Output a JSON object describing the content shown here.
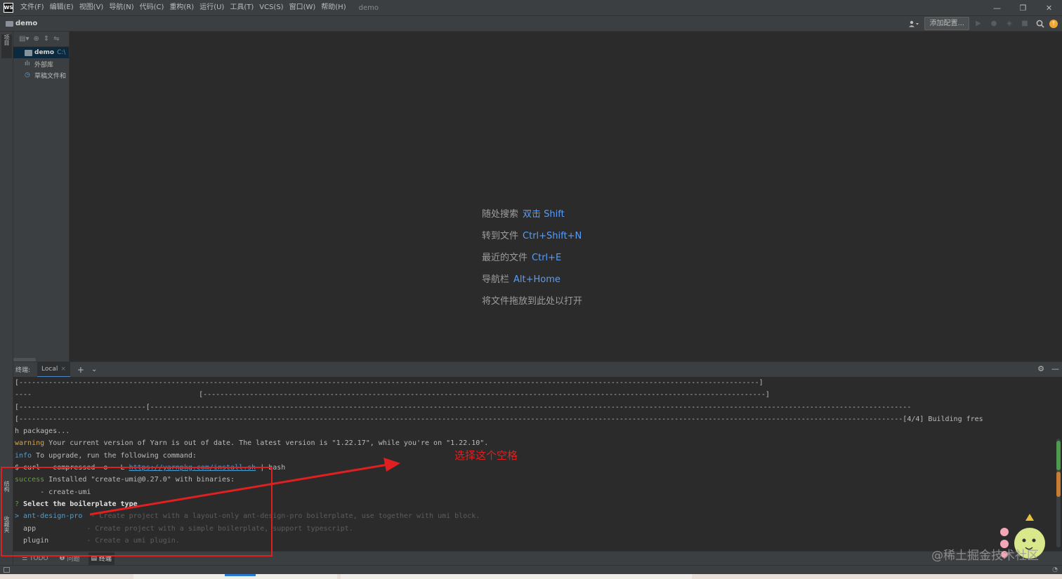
{
  "titlebar": {
    "logo": "WS",
    "menu": [
      "文件(F)",
      "编辑(E)",
      "视图(V)",
      "导航(N)",
      "代码(C)",
      "重构(R)",
      "运行(U)",
      "工具(T)",
      "VCS(S)",
      "窗口(W)",
      "帮助(H)"
    ],
    "window_title": "demo",
    "controls": {
      "minimize": "—",
      "restore": "❐",
      "close": "✕"
    }
  },
  "navbar": {
    "project": "demo",
    "add_config": "添加配置..."
  },
  "left_stripe": {
    "project_tab": "项目",
    "structure_tab": "结构",
    "favorites_tab": "收藏夹"
  },
  "project_tree": {
    "items": [
      {
        "label": "demo",
        "path": "C:\\",
        "icon": "folder-icon"
      },
      {
        "label": "外部库",
        "icon": "library-icon"
      },
      {
        "label": "草稿文件和",
        "icon": "scratch-icon"
      }
    ]
  },
  "editor_hints": [
    {
      "label": "随处搜索",
      "key": "双击 Shift"
    },
    {
      "label": "转到文件",
      "key": "Ctrl+Shift+N"
    },
    {
      "label": "最近的文件",
      "key": "Ctrl+E"
    },
    {
      "label": "导航栏",
      "key": "Alt+Home"
    },
    {
      "label": "将文件拖放到此处以打开",
      "key": ""
    }
  ],
  "terminal": {
    "title": "终端:",
    "tab": "Local",
    "lines": {
      "l1": "[-------------------------------------------------------------------------------------------------------------------------------------------------------------------------------]",
      "l2a": "----",
      "l2b": "[-------------------------------------------------------------------------------------------------------------------------------------]",
      "l3a": "[------------------------------[",
      "l3b": "------------------------------------------------------------------------------------------------------------------------------------------------------------------------------------",
      "l3c": "[--",
      "l4": "[-----------------------------------------------------------------------------------------------------------------------------------------------------------------------------------------------------------------[4/4] Building fres",
      "l5": "h packages...",
      "warning_tag": "warning",
      "warning_text": " Your current version of Yarn is out of date. The latest version is \"1.22.17\", while you're on \"1.22.10\".",
      "info_tag": "info",
      "info_text": " To upgrade, run the following command:",
      "curl_pre": "$ curl --compressed -o- -L ",
      "curl_link": "https://yarnpkg.com/install.sh",
      "curl_post": " | bash",
      "success_tag": "success",
      "success_text": " Installed \"create-umi@0.27.0\" with binaries:",
      "binary": "      - create-umi",
      "q_mark": "?",
      "question": " Select the boilerplate type",
      "opt1_pointer": "> ",
      "opt1_name": "ant-design-pro",
      "opt1_desc": "  - Create project with a layout-only ant-design-pro boilerplate, use together with umi block.",
      "opt2_name": "  app",
      "opt2_desc": "            - Create project with a simple boilerplate, support typescript.",
      "opt3_name": "  plugin",
      "opt3_desc": "         - Create a umi plugin."
    }
  },
  "bottom_tools": [
    "TODO",
    "问题",
    "终端"
  ],
  "annotation": {
    "text": "选择这个空格",
    "color": "#e02020"
  },
  "watermark": "@稀土掘金技术社区",
  "colors": {
    "accent": "#589df6",
    "warning": "#d9a343",
    "info": "#4f9fd1",
    "success": "#6a9a3e"
  }
}
